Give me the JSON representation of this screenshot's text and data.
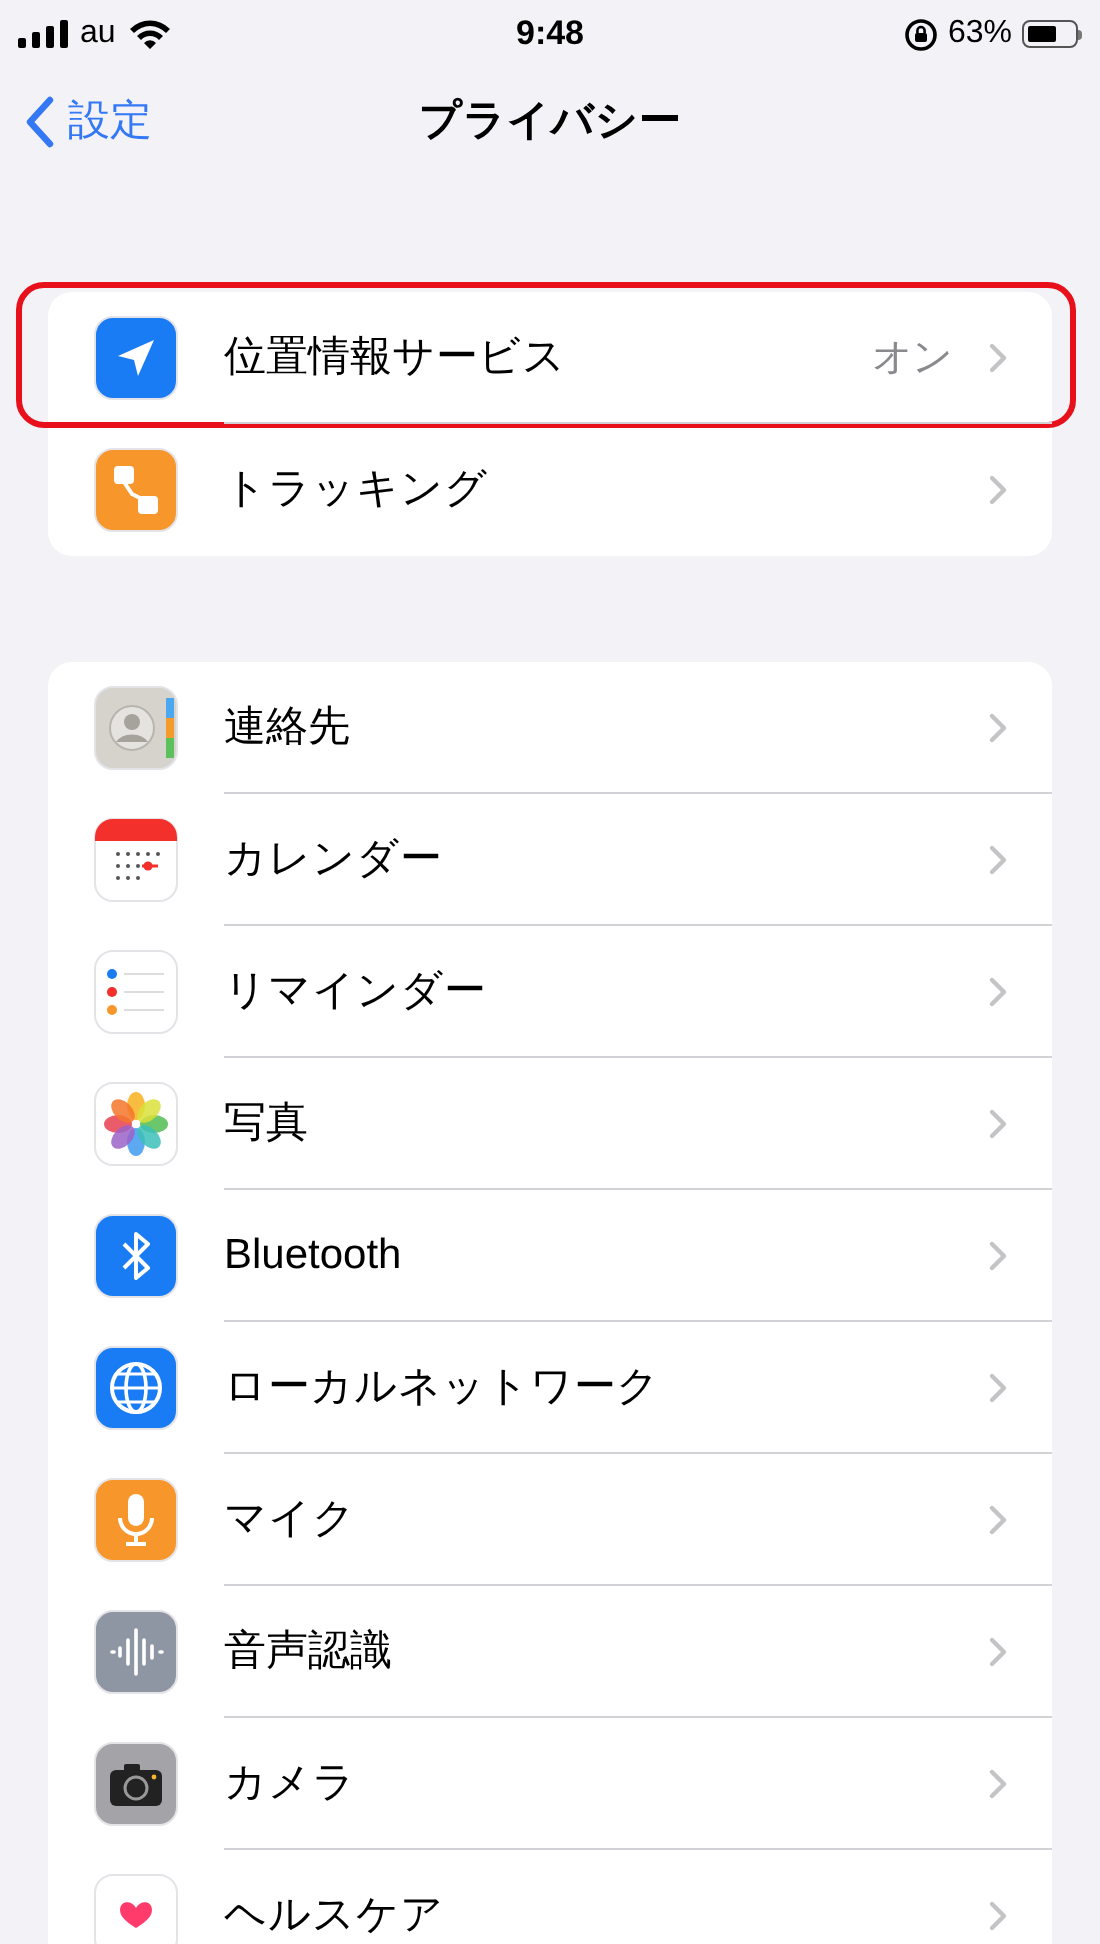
{
  "status_bar": {
    "carrier": "au",
    "time": "9:48",
    "battery_percent": "63%"
  },
  "nav": {
    "back": "設定",
    "title": "プライバシー"
  },
  "sections": [
    {
      "rows": [
        {
          "label": "位置情報サービス",
          "value": "オン",
          "highlighted": true
        },
        {
          "label": "トラッキング",
          "highlighted": false
        }
      ]
    },
    {
      "rows": [
        {
          "label": "連絡先",
          "highlighted": false
        },
        {
          "label": "カレンダー",
          "highlighted": false
        },
        {
          "label": "リマインダー",
          "highlighted": false
        },
        {
          "label": "写真",
          "highlighted": false
        },
        {
          "label": "Bluetooth",
          "highlighted": false
        },
        {
          "label": "ローカルネットワーク",
          "highlighted": false
        },
        {
          "label": "マイク",
          "highlighted": false
        },
        {
          "label": "音声認識",
          "highlighted": false
        },
        {
          "label": "カメラ",
          "highlighted": false
        },
        {
          "label": "ヘルスケア",
          "highlighted": false
        }
      ]
    }
  ]
}
